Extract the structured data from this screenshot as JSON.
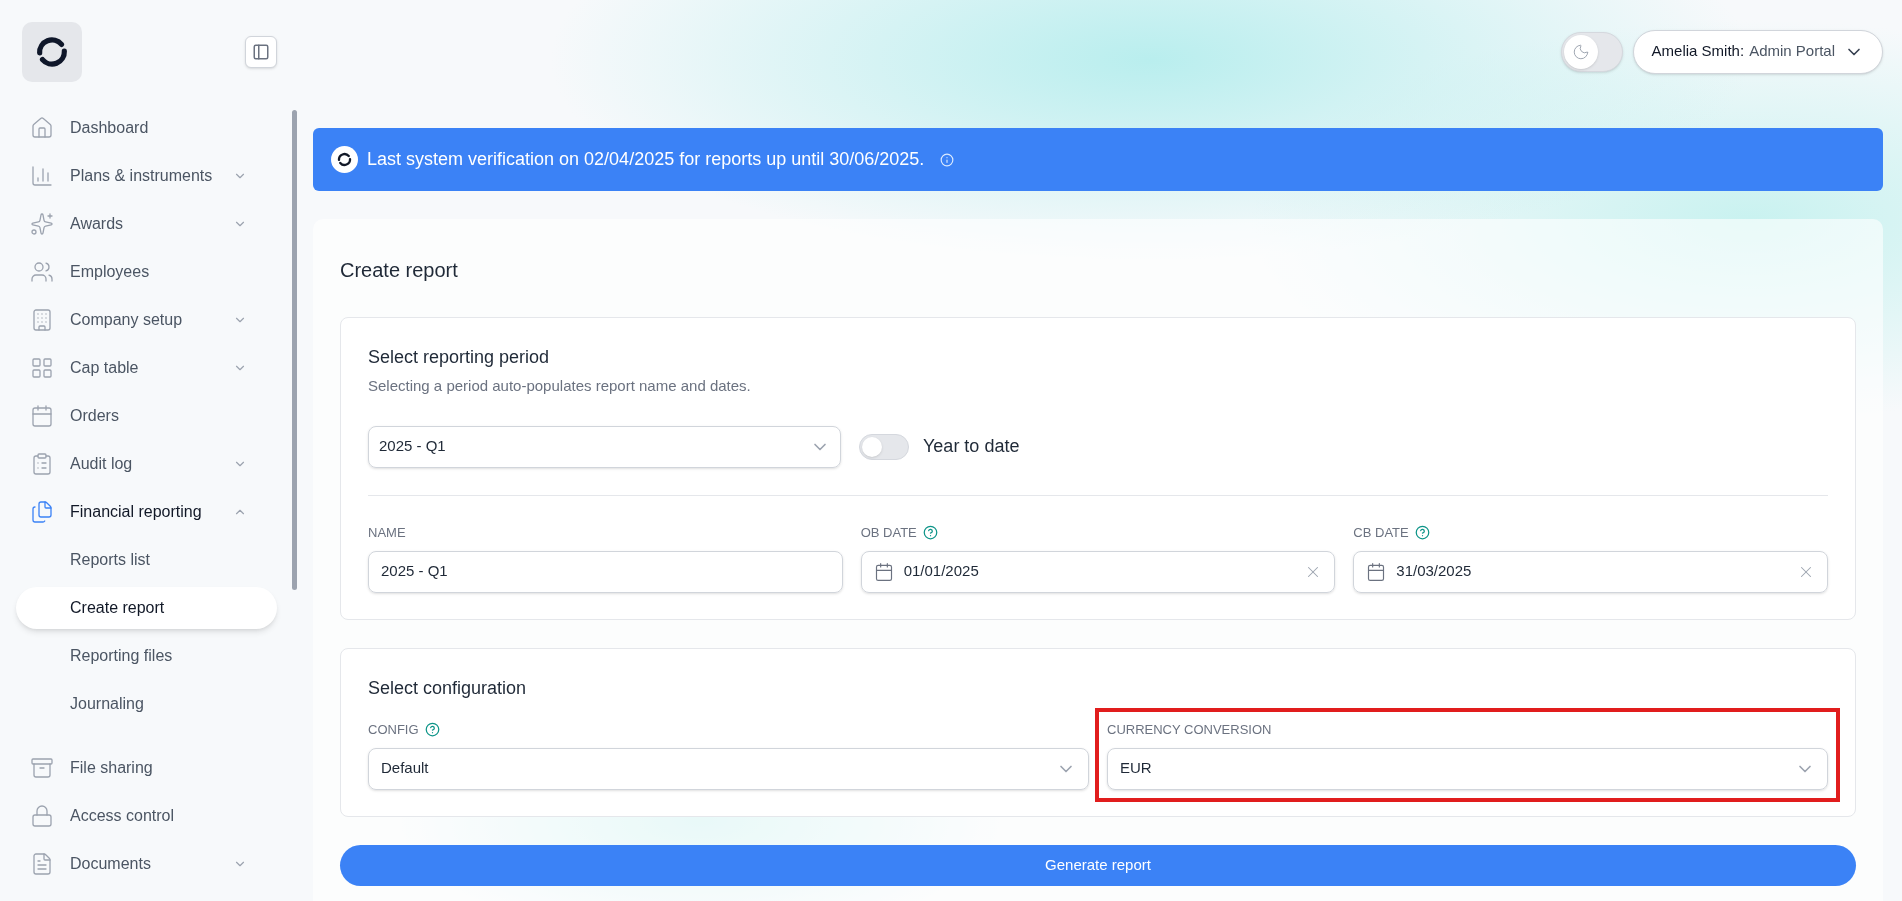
{
  "sidebar": {
    "items": [
      {
        "label": "Dashboard",
        "selected": false
      },
      {
        "label": "Plans & instruments",
        "selected": false,
        "expanded": false
      },
      {
        "label": "Awards",
        "selected": false,
        "expanded": false
      },
      {
        "label": "Employees",
        "selected": false
      },
      {
        "label": "Company setup",
        "selected": false,
        "expanded": false
      },
      {
        "label": "Cap table",
        "selected": false,
        "expanded": false
      },
      {
        "label": "Orders",
        "selected": false
      },
      {
        "label": "Audit log",
        "selected": false,
        "expanded": false
      },
      {
        "label": "Financial reporting",
        "selected": true,
        "expanded": true,
        "children": [
          {
            "label": "Reports list",
            "selected": false
          },
          {
            "label": "Create report",
            "selected": true
          },
          {
            "label": "Reporting files",
            "selected": false
          },
          {
            "label": "Journaling",
            "selected": false
          }
        ]
      },
      {
        "label": "File sharing",
        "selected": false
      },
      {
        "label": "Access control",
        "selected": false
      },
      {
        "label": "Documents",
        "selected": false,
        "expanded": false
      }
    ]
  },
  "header": {
    "dark_mode": {
      "on": false
    },
    "user": {
      "name": "Amelia Smith:",
      "portal": "Admin Portal"
    }
  },
  "banner": {
    "text": "Last system verification on 02/04/2025 for reports up until 30/06/2025."
  },
  "page": {
    "title": "Create report",
    "period_section": {
      "title": "Select reporting period",
      "subtitle": "Selecting a period auto-populates report name and dates.",
      "period": "2025 - Q1",
      "year_to_date": {
        "label": "Year to date",
        "on": false
      },
      "fields": [
        {
          "label": "NAME",
          "value": "2025 - Q1",
          "kind": "text"
        },
        {
          "label": "OB DATE",
          "value": "01/01/2025",
          "kind": "date",
          "help": true
        },
        {
          "label": "CB DATE",
          "value": "31/03/2025",
          "kind": "date",
          "help": true
        }
      ]
    },
    "config_section": {
      "title": "Select configuration",
      "fields": [
        {
          "label": "CONFIG",
          "value": "Default",
          "help": true,
          "highlighted": false
        },
        {
          "label": "CURRENCY CONVERSION",
          "value": "EUR",
          "help": false,
          "highlighted": true
        }
      ]
    },
    "submit": "Generate report"
  }
}
